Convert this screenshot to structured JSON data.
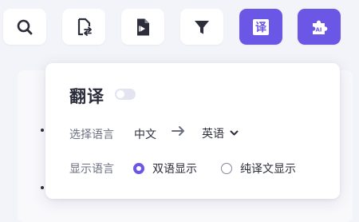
{
  "toolbar": {
    "buttons": [
      {
        "name": "search",
        "icon": "search-icon"
      },
      {
        "name": "doc-convert",
        "icon": "document-swap-icon"
      },
      {
        "name": "file-play",
        "icon": "file-play-icon"
      },
      {
        "name": "filter",
        "icon": "filter-icon"
      },
      {
        "name": "translate",
        "icon": "translate-icon",
        "glyph": "译",
        "active": true
      },
      {
        "name": "ai-plugin",
        "icon": "ai-puzzle-icon",
        "glyph": "AI",
        "active": true
      }
    ],
    "accent": "#6b57e6"
  },
  "popover": {
    "title": "翻译",
    "toggle_on": false,
    "language_row": {
      "label": "选择语言",
      "source": "中文",
      "target": "英语"
    },
    "display_row": {
      "label": "显示语言",
      "options": [
        {
          "label": "双语显示",
          "checked": true
        },
        {
          "label": "纯译文显示",
          "checked": false
        }
      ]
    }
  }
}
